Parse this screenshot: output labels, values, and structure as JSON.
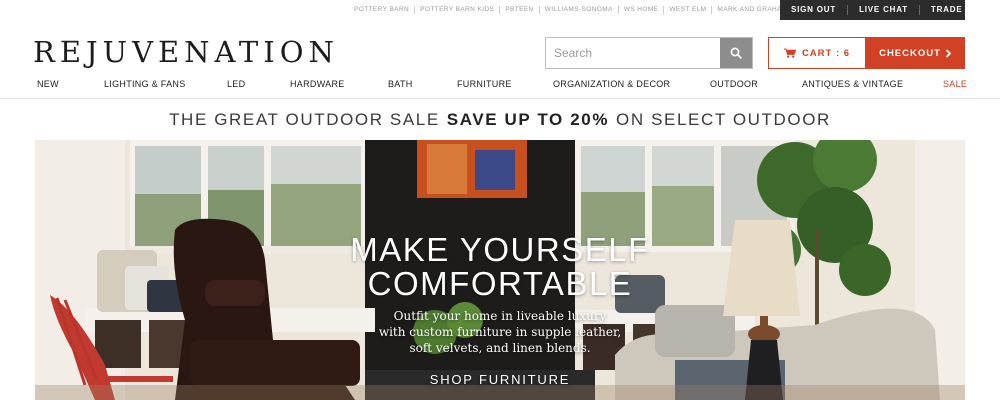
{
  "brand_links": [
    "POTTERY BARN",
    "POTTERY BARN KIDS",
    "PBTEEN",
    "WILLIAMS-SONOMA",
    "WS HOME",
    "WEST ELM",
    "MARK AND GRAHAM"
  ],
  "account_links": [
    "SIGN OUT",
    "LIVE CHAT",
    "TRADE"
  ],
  "logo": "REJUVENATION",
  "search": {
    "placeholder": "Search",
    "value": ""
  },
  "cart": {
    "label": "CART : 6"
  },
  "checkout": {
    "label": "CHECKOUT"
  },
  "nav": [
    "NEW",
    "LIGHTING & FANS",
    "LED",
    "HARDWARE",
    "BATH",
    "FURNITURE",
    "ORGANIZATION & DECOR",
    "OUTDOOR",
    "ANTIQUES & VINTAGE",
    "SALE"
  ],
  "promo": {
    "prefix": "THE GREAT OUTDOOR SALE",
    "highlight": "SAVE UP TO 20%",
    "suffix": "ON SELECT OUTDOOR"
  },
  "hero": {
    "title_line1": "MAKE YOURSELF",
    "title_line2": "COMFORTABLE",
    "body_line1": "Outfit your home in liveable luxury",
    "body_line2": "with custom furniture in supple leather,",
    "body_line3": "soft velvets, and linen blends.",
    "cta": "SHOP FURNITURE"
  },
  "colors": {
    "accent": "#d14124",
    "account_bar": "#2c2c2c",
    "search_button": "#8d8d8d"
  }
}
